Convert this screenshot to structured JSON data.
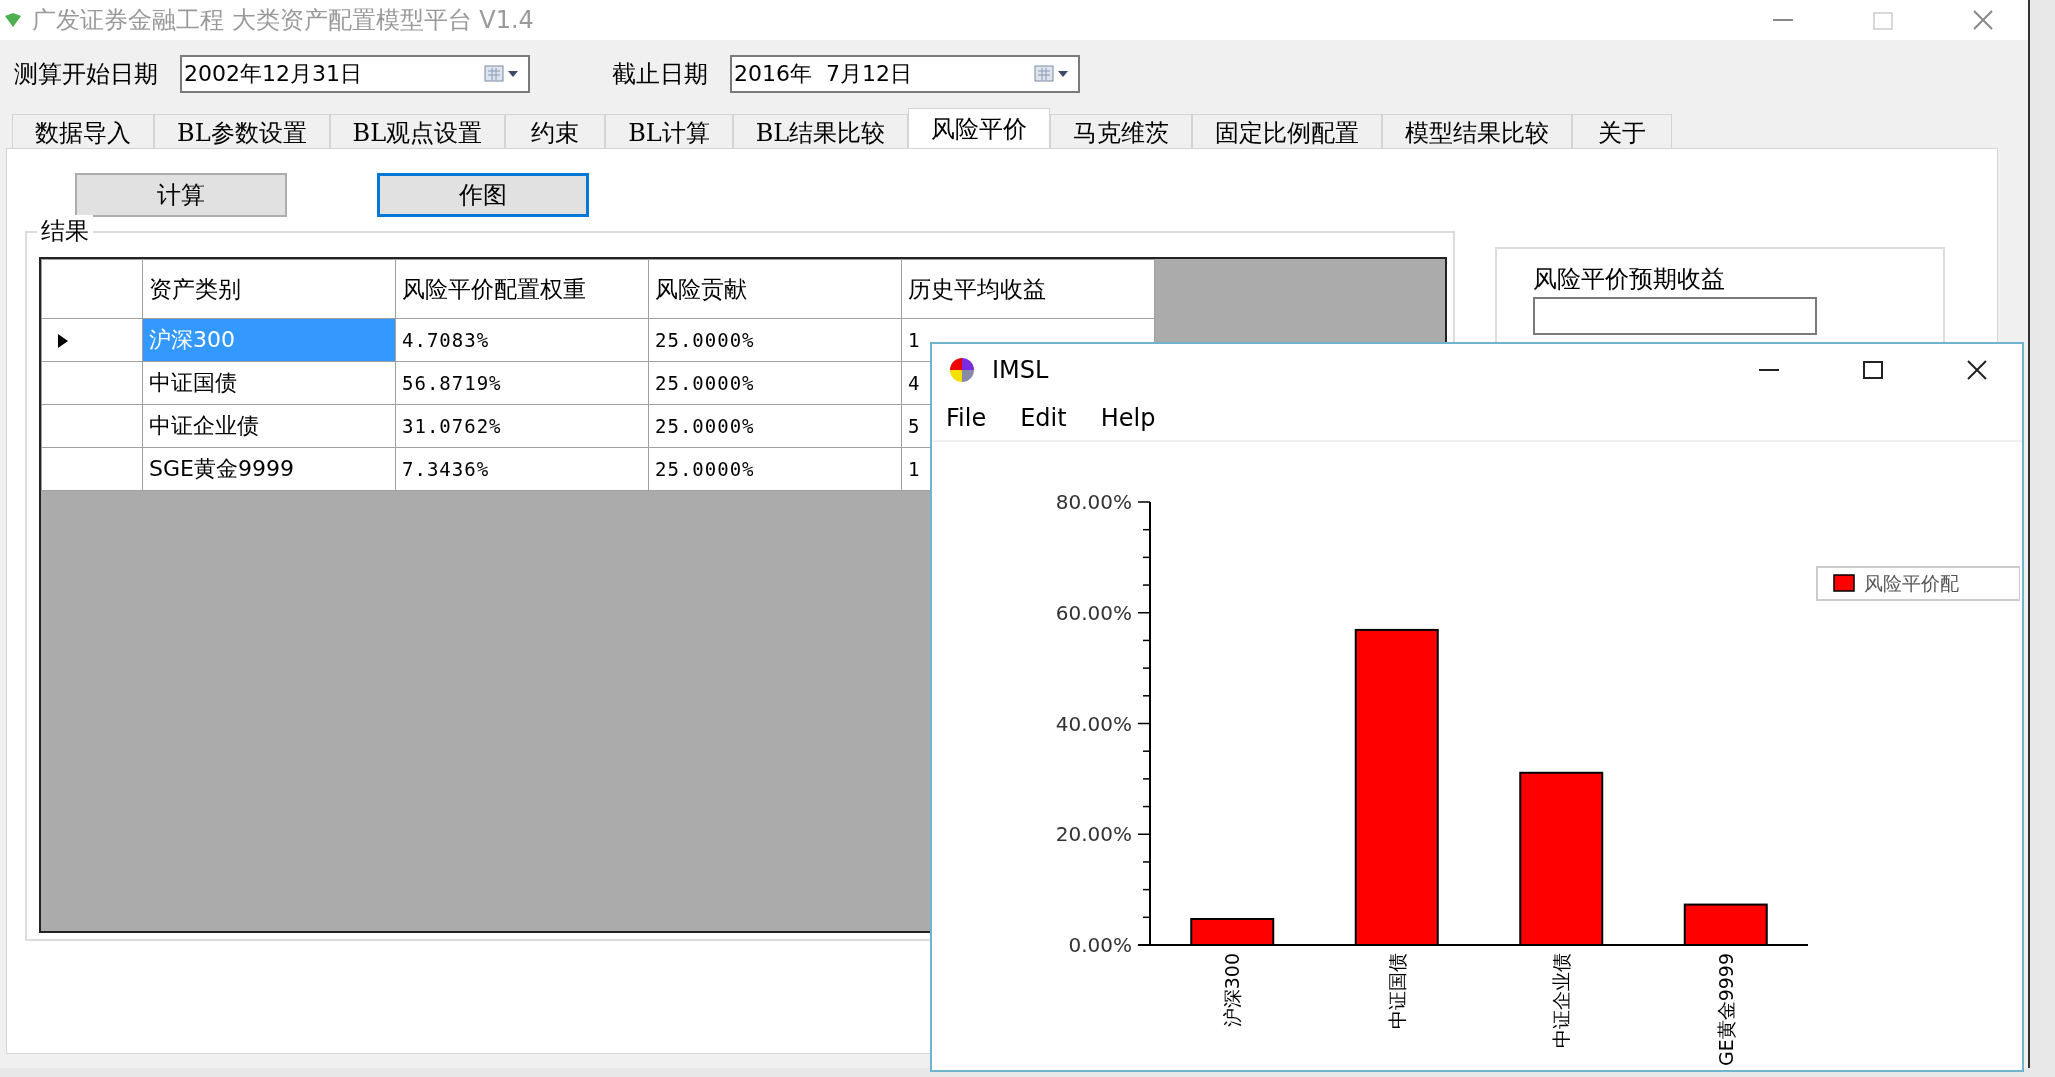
{
  "window": {
    "title": "广发证券金融工程 大类资产配置模型平台 V1.4"
  },
  "dates": [
    {
      "label": "测算开始日期",
      "value": "2002年12月31日"
    },
    {
      "label": "截止日期",
      "value": "2016年  7月12日"
    }
  ],
  "tabs": [
    {
      "label": "数据导入",
      "selected": false
    },
    {
      "label": "BL参数设置",
      "selected": false
    },
    {
      "label": "BL观点设置",
      "selected": false
    },
    {
      "label": "约束",
      "selected": false
    },
    {
      "label": "BL计算",
      "selected": false
    },
    {
      "label": "BL结果比较",
      "selected": false
    },
    {
      "label": "风险平价",
      "selected": true
    },
    {
      "label": "马克维茨",
      "selected": false
    },
    {
      "label": "固定比例配置",
      "selected": false
    },
    {
      "label": "模型结果比较",
      "selected": false
    },
    {
      "label": "关于",
      "selected": false
    }
  ],
  "buttons": [
    {
      "label": "计算",
      "focused": false
    },
    {
      "label": "作图",
      "focused": true
    }
  ],
  "results": {
    "title": "结果",
    "table": {
      "columns": [
        "资产类别",
        "风险平价配置权重",
        "风险贡献",
        "历史平均收益"
      ],
      "rows": [
        {
          "selected": true,
          "cells": [
            "沪深300",
            "4.7083%",
            "25.0000%",
            "1"
          ]
        },
        {
          "selected": false,
          "cells": [
            "中证国债",
            "56.8719%",
            "25.0000%",
            "4"
          ]
        },
        {
          "selected": false,
          "cells": [
            "中证企业债",
            "31.0762%",
            "25.0000%",
            "5"
          ]
        },
        {
          "selected": false,
          "cells": [
            "SGE黄金9999",
            "7.3436%",
            "25.0000%",
            "1"
          ]
        }
      ]
    }
  },
  "expected_return": {
    "label": "风险平价预期收益"
  },
  "chart_window": {
    "title": "IMSL",
    "menu": [
      "File",
      "Edit",
      "Help"
    ],
    "chart_data": {
      "type": "bar",
      "categories": [
        "沪深300",
        "中证国债",
        "中证企业债",
        "GE黄金9999"
      ],
      "series": [
        {
          "name": "风险平价配",
          "color": "#ff0000",
          "values": [
            4.7,
            56.9,
            31.1,
            7.3
          ]
        }
      ],
      "ylim": [
        0,
        80
      ],
      "yticks": [
        {
          "value": 0,
          "label": "0.00%"
        },
        {
          "value": 20,
          "label": "20.00%"
        },
        {
          "value": 40,
          "label": "40.00%"
        },
        {
          "value": 60,
          "label": "60.00%"
        },
        {
          "value": 80,
          "label": "80.00%"
        }
      ]
    }
  }
}
